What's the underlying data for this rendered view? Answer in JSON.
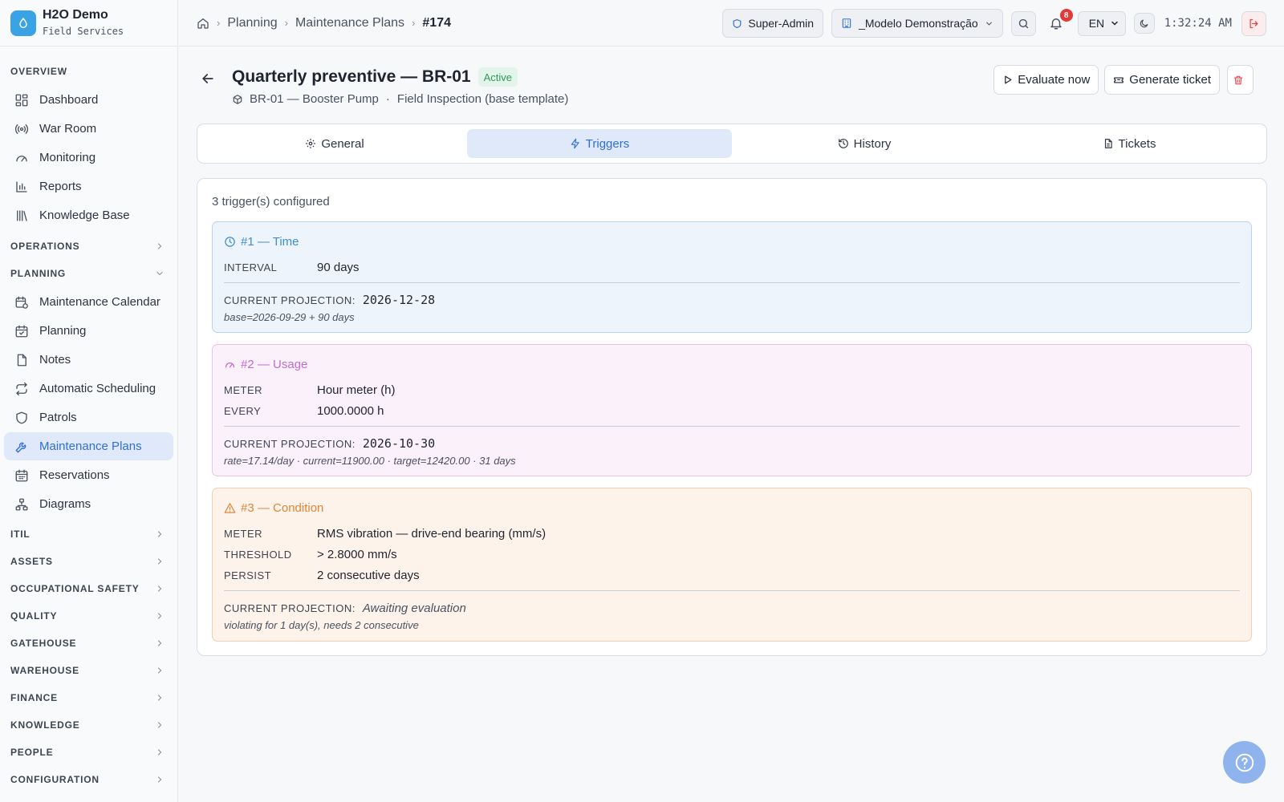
{
  "brand": {
    "name": "H2O Demo",
    "subtitle": "Field Services"
  },
  "sidebar": {
    "overview": {
      "label": "OVERVIEW"
    },
    "overview_items": [
      {
        "label": "Dashboard",
        "icon": "dashboard-icon"
      },
      {
        "label": "War Room",
        "icon": "broadcast-icon"
      },
      {
        "label": "Monitoring",
        "icon": "gauge-icon"
      },
      {
        "label": "Reports",
        "icon": "bar-chart-icon"
      },
      {
        "label": "Knowledge Base",
        "icon": "library-icon"
      }
    ],
    "operations": {
      "label": "OPERATIONS"
    },
    "planning": {
      "label": "PLANNING"
    },
    "planning_items": [
      {
        "label": "Maintenance Calendar",
        "icon": "calendar-clock-icon"
      },
      {
        "label": "Planning",
        "icon": "calendar-check-icon"
      },
      {
        "label": "Notes",
        "icon": "file-icon"
      },
      {
        "label": "Automatic Scheduling",
        "icon": "repeat-icon"
      },
      {
        "label": "Patrols",
        "icon": "shield-icon"
      },
      {
        "label": "Maintenance Plans",
        "icon": "wrench-icon",
        "active": true
      },
      {
        "label": "Reservations",
        "icon": "calendar-icon"
      },
      {
        "label": "Diagrams",
        "icon": "network-icon"
      }
    ],
    "groups": [
      "ITIL",
      "ASSETS",
      "OCCUPATIONAL SAFETY",
      "QUALITY",
      "GATEHOUSE",
      "WAREHOUSE",
      "FINANCE",
      "KNOWLEDGE",
      "PEOPLE",
      "CONFIGURATION"
    ]
  },
  "breadcrumb": [
    "Planning",
    "Maintenance Plans",
    "#174"
  ],
  "topbar": {
    "role": "Super-Admin",
    "tenant": "_Modelo Demonstração",
    "notifications": "8",
    "language": "EN",
    "time": "1:32:24 AM"
  },
  "plan": {
    "title": "Quarterly preventive — BR-01",
    "status": "Active",
    "asset": "BR-01 — Booster Pump",
    "separator": "·",
    "template": "Field Inspection (base template)"
  },
  "actions": {
    "evaluate": "Evaluate now",
    "generate": "Generate ticket"
  },
  "tabs": [
    {
      "label": "General",
      "icon": "gear-icon"
    },
    {
      "label": "Triggers",
      "icon": "zap-icon",
      "active": true
    },
    {
      "label": "History",
      "icon": "history-icon"
    },
    {
      "label": "Tickets",
      "icon": "document-icon"
    }
  ],
  "triggers": {
    "count_text": "3 trigger(s) configured",
    "time": {
      "title": "#1 — Time",
      "color": "#3f8ed0",
      "interval_label": "INTERVAL",
      "interval_value": "90 days",
      "projection_label": "CURRENT PROJECTION:",
      "projection_value": "2026-12-28",
      "note": "base=2026-09-29 + 90 days"
    },
    "usage": {
      "title": "#2 — Usage",
      "color": "#c36cd0",
      "meter_label": "METER",
      "meter_value": "Hour meter (h)",
      "every_label": "EVERY",
      "every_value": "1000.0000 h",
      "projection_label": "CURRENT PROJECTION:",
      "projection_value": "2026-10-30",
      "note": "rate=17.14/day · current=11900.00 · target=12420.00 · 31 days"
    },
    "condition": {
      "title": "#3 — Condition",
      "color": "#e0863a",
      "meter_label": "METER",
      "meter_value": "RMS vibration — drive-end bearing (mm/s)",
      "threshold_label": "THRESHOLD",
      "threshold_value": "> 2.8000 mm/s",
      "persist_label": "PERSIST",
      "persist_value": "2 consecutive days",
      "projection_label": "CURRENT PROJECTION:",
      "projection_value": "Awaiting evaluation",
      "note": "violating for 1 day(s), needs 2 consecutive"
    }
  },
  "colors": {
    "accent": "#2f6fd6",
    "active_bg": "#dfe9f9",
    "status_green": "#2e9a5a",
    "danger": "#e24a4a"
  }
}
